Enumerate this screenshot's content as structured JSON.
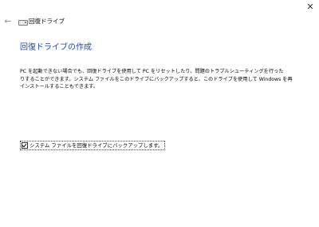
{
  "window": {
    "title": "回復ドライブ",
    "back_glyph": "←",
    "close_glyph": "✕"
  },
  "main": {
    "heading": "回復ドライブの作成",
    "description_lines": [
      "PC を起動できない場合でも、回復ドライブを使用して PC をリセットしたり、問題のトラブルシューティングを行った",
      "りすることができます。システム ファイルをこのドライブにバックアップすると、このドライブを使用して Windows を再",
      "インストールすることもできます。"
    ],
    "backup_checkbox": {
      "label": "システム ファイルを回復ドライブにバックアップします。",
      "checked": true
    }
  },
  "colors": {
    "heading": "#1c4a9c",
    "background": "#ffffff"
  },
  "icons": [
    "back-arrow-icon",
    "drive-icon",
    "close-icon",
    "checkmark-icon"
  ]
}
